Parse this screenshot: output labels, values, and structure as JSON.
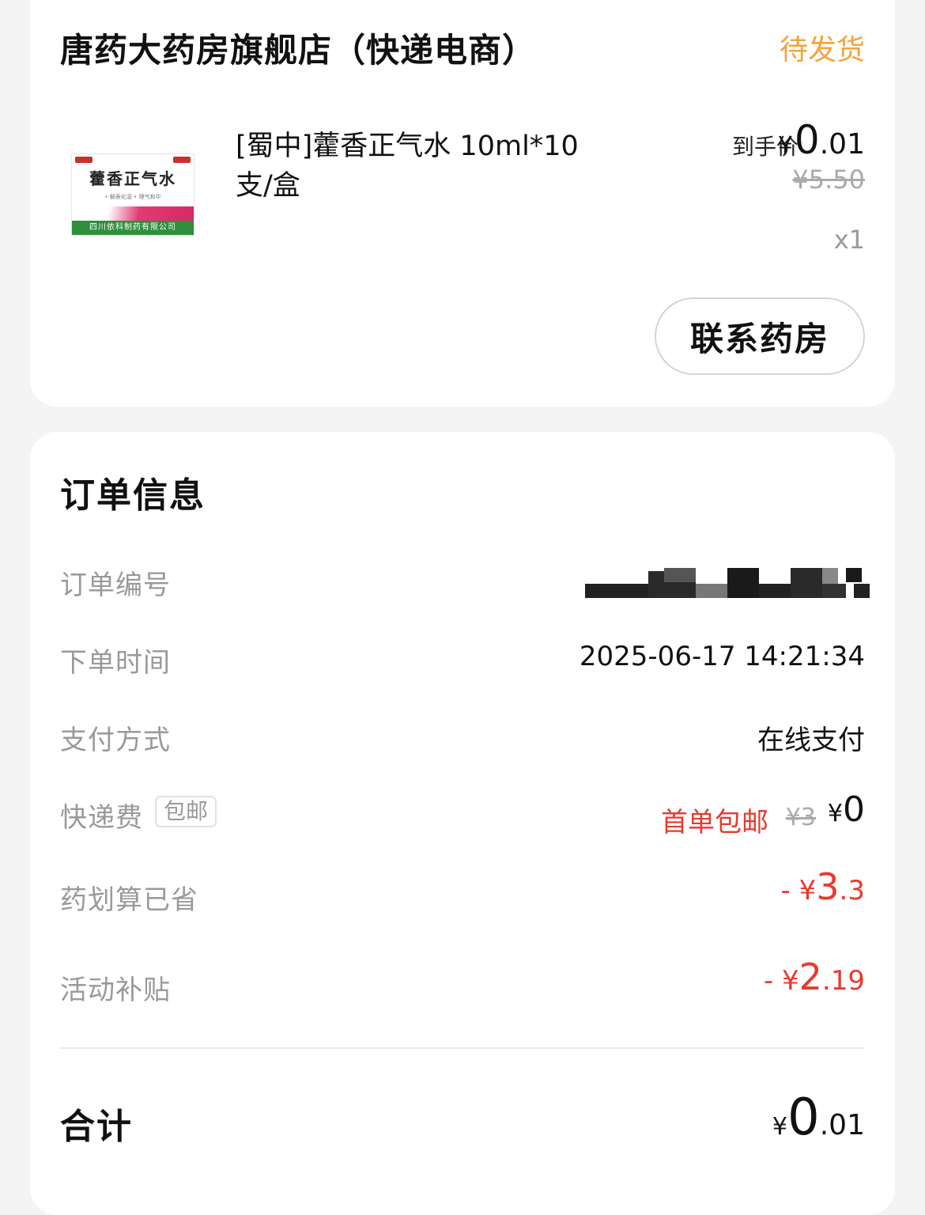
{
  "store": {
    "name": "唐药大药房旗舰店（快递电商）",
    "status": "待发货",
    "status_color": "#f3a33a"
  },
  "product": {
    "name": "[蜀中]藿香正气水 10ml*10支/盒",
    "image": {
      "title": "藿香正气水",
      "bullets": "• 解表化湿  • 理气和中",
      "manufacturer": "四川依科制药有限公司"
    },
    "price_label": "到手价",
    "currency": "¥",
    "price_int": "0",
    "price_dec": ".01",
    "original_price": "¥5.50",
    "quantity": "x1",
    "contact_button": "联系药房"
  },
  "order_info": {
    "title": "订单信息",
    "order_no_label": "订单编号",
    "time_label": "下单时间",
    "time_value": "2025-06-17 14:21:34",
    "payment_label": "支付方式",
    "payment_value": "在线支付",
    "shipping_label": "快递费",
    "shipping_tag": "包邮",
    "shipping_first": "首单包邮",
    "shipping_original": "¥3",
    "shipping_currency": "¥",
    "shipping_now": "0",
    "saved_label": "药划算已省",
    "saved_sign": "- ¥",
    "saved_int": "3",
    "saved_dec": ".3",
    "subsidy_label": "活动补贴",
    "subsidy_sign": "- ¥",
    "subsidy_int": "2",
    "subsidy_dec": ".19",
    "total_label": "合计",
    "total_currency": "¥",
    "total_int": "0",
    "total_dec": ".01",
    "accent_red": "#e83a2e"
  }
}
